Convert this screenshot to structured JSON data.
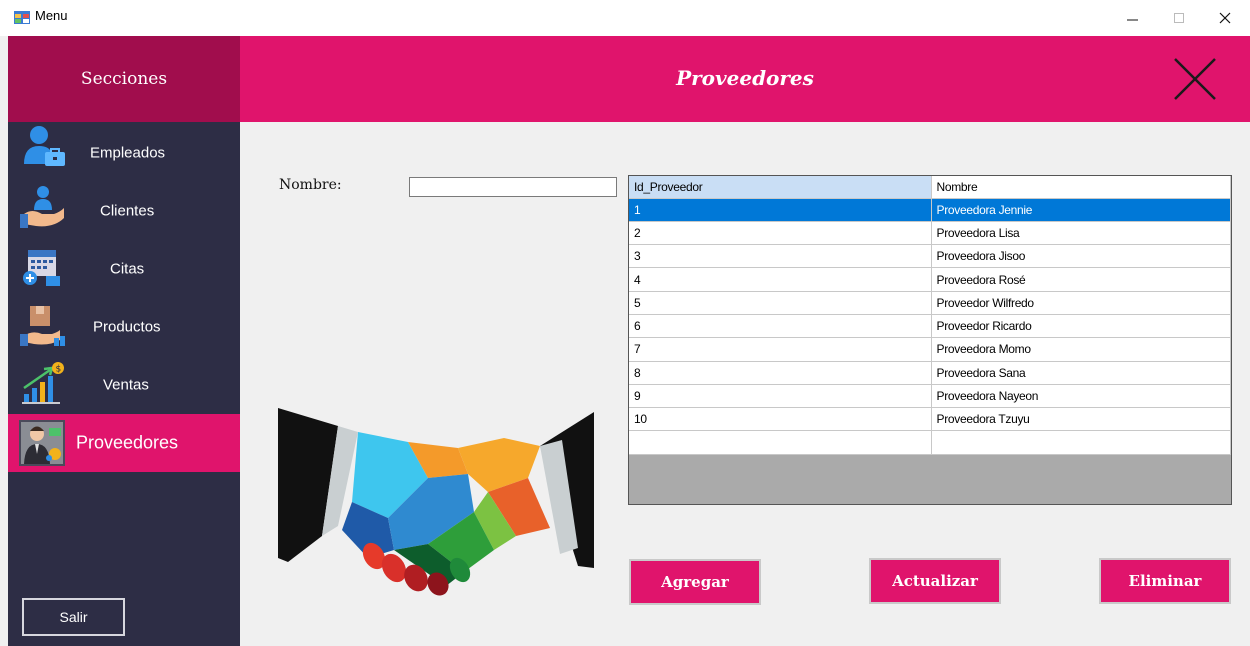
{
  "window": {
    "title": "Menu",
    "minimize": "—",
    "maximize": "☐",
    "close": "✕"
  },
  "sidebar": {
    "header": "Secciones",
    "items": [
      {
        "label": "Empleados",
        "icon": "employee-icon"
      },
      {
        "label": "Clientes",
        "icon": "client-icon"
      },
      {
        "label": "Citas",
        "icon": "calendar-icon"
      },
      {
        "label": "Productos",
        "icon": "product-box-icon"
      },
      {
        "label": "Ventas",
        "icon": "sales-chart-icon"
      },
      {
        "label": "Proveedores",
        "icon": "supplier-icon",
        "active": true
      }
    ],
    "exit_label": "Salir"
  },
  "header": {
    "title": "Proveedores",
    "close_icon": "close-x-icon"
  },
  "form": {
    "nombre_label": "Nombre:",
    "nombre_value": ""
  },
  "grid": {
    "columns": [
      "Id_Proveedor",
      "Nombre"
    ],
    "rows": [
      [
        "1",
        "Proveedora Jennie"
      ],
      [
        "2",
        "Proveedora Lisa"
      ],
      [
        "3",
        "Proveedora Jisoo"
      ],
      [
        "4",
        "Proveedora Rosé"
      ],
      [
        "5",
        "Proveedor Wilfredo"
      ],
      [
        "6",
        "Proveedor Ricardo"
      ],
      [
        "7",
        "Proveedora Momo"
      ],
      [
        "8",
        "Proveedora Sana"
      ],
      [
        "9",
        "Proveedora Nayeon"
      ],
      [
        "10",
        "Proveedora Tzuyu"
      ],
      [
        "",
        ""
      ]
    ],
    "selected_row": 0
  },
  "buttons": {
    "add": "Agregar",
    "update": "Actualizar",
    "delete": "Eliminar"
  },
  "colors": {
    "accent": "#e0146c",
    "sidebar_header": "#a10d4d",
    "sidebar_bg": "#2d2d45",
    "selection": "#0078d7"
  }
}
